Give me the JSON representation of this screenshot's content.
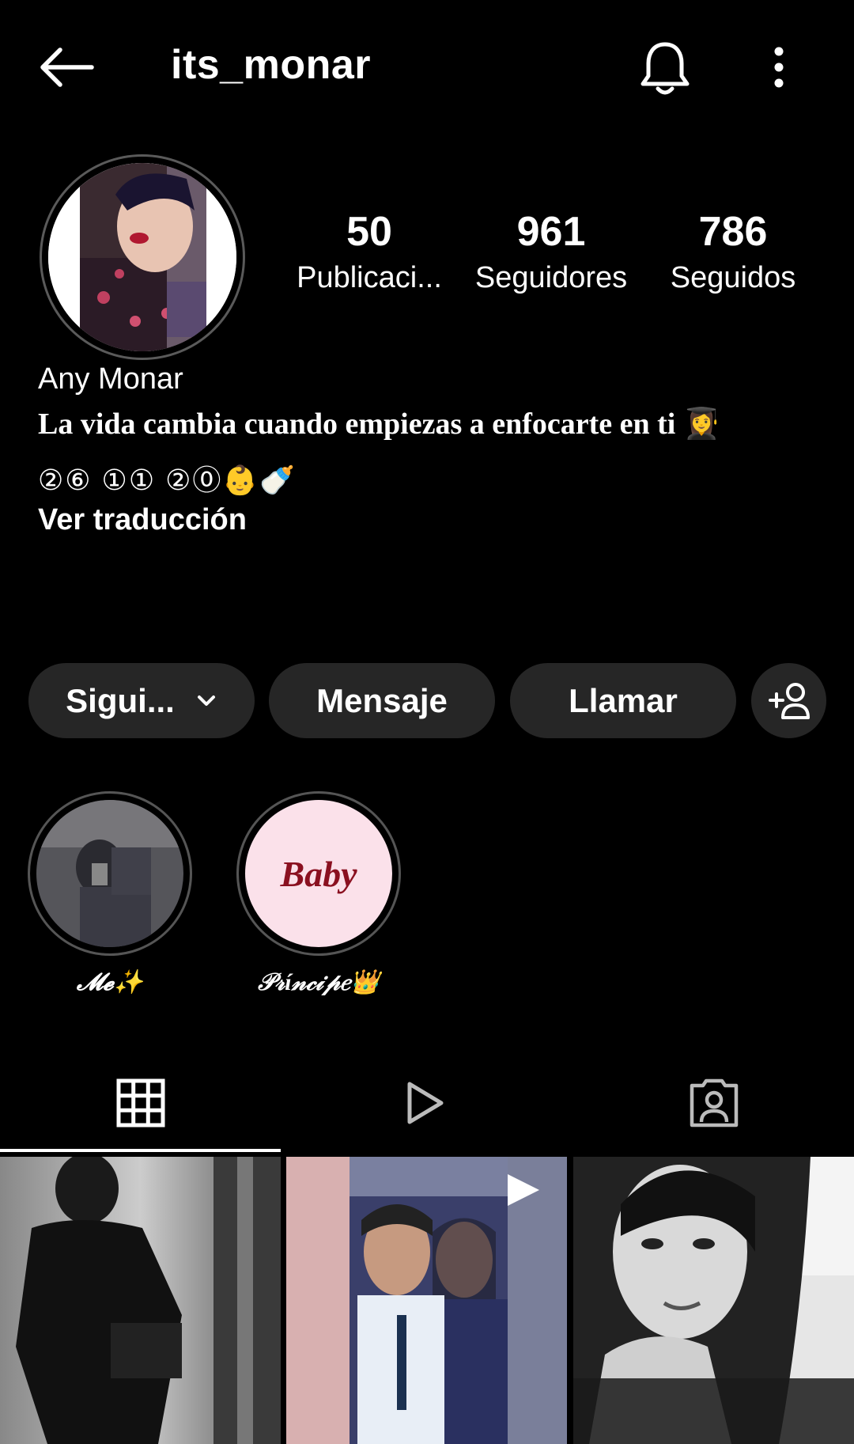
{
  "header": {
    "username": "its_monar",
    "back_icon": "arrow-left-icon",
    "bell_icon": "bell-icon",
    "more_icon": "vertical-dots-icon"
  },
  "stats": {
    "posts": {
      "value": "50",
      "label": "Publicaci..."
    },
    "followers": {
      "value": "961",
      "label": "Seguidores"
    },
    "following": {
      "value": "786",
      "label": "Seguidos"
    }
  },
  "bio": {
    "name": "Any Monar",
    "line1": "La vida cambia cuando empiezas a enfocarte en ti 👩‍🎓",
    "line2": "②⑥ ①① ②⓪👶🍼",
    "translate": "Ver traducción"
  },
  "actions": {
    "follow_label": "Sigui...",
    "message_label": "Mensaje",
    "call_label": "Llamar",
    "add_icon": "person-plus-icon"
  },
  "highlights": [
    {
      "label": "𝓜𝓮✨",
      "cover_text": ""
    },
    {
      "label": "𝒫𝓇í𝓃𝒸𝒾𝓅𝑒👑",
      "cover_text": "Baby"
    }
  ],
  "tabs": [
    {
      "icon": "grid-icon"
    },
    {
      "icon": "reels-play-icon"
    },
    {
      "icon": "tagged-person-icon"
    }
  ],
  "colors": {
    "background": "#000000",
    "button_bg": "#262626",
    "text": "#ffffff"
  }
}
